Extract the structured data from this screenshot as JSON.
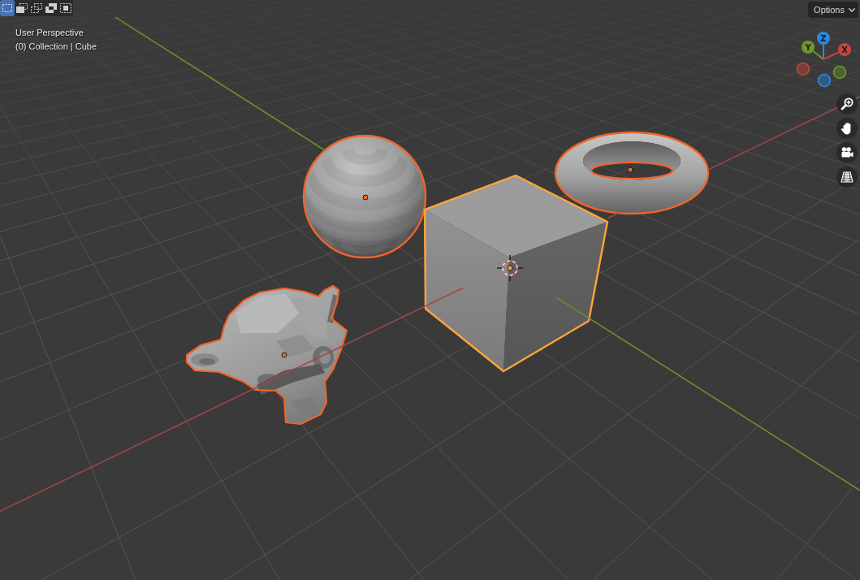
{
  "header": {
    "select_modes": [
      {
        "kind": "new",
        "selected": true
      },
      {
        "kind": "extend",
        "selected": false
      },
      {
        "kind": "subtract",
        "selected": false
      },
      {
        "kind": "difference",
        "selected": false
      },
      {
        "kind": "intersect",
        "selected": false
      }
    ],
    "options": {
      "label": "Options"
    }
  },
  "view_info": {
    "view": "User Perspective",
    "context": "(0) Collection | Cube"
  },
  "navigation_gizmo": {
    "axes": [
      {
        "label": "Z",
        "color": "#2e86e0"
      },
      {
        "label": "Y",
        "color": "#6f9a26"
      },
      {
        "label": "X",
        "color": "#c9453a"
      }
    ]
  },
  "scene": {
    "objects": [
      {
        "kind": "sphere",
        "selected": true,
        "active": false
      },
      {
        "kind": "torus",
        "selected": true,
        "active": false
      },
      {
        "kind": "cube",
        "selected": true,
        "active": true
      },
      {
        "kind": "monkey",
        "selected": true,
        "active": false
      }
    ]
  }
}
